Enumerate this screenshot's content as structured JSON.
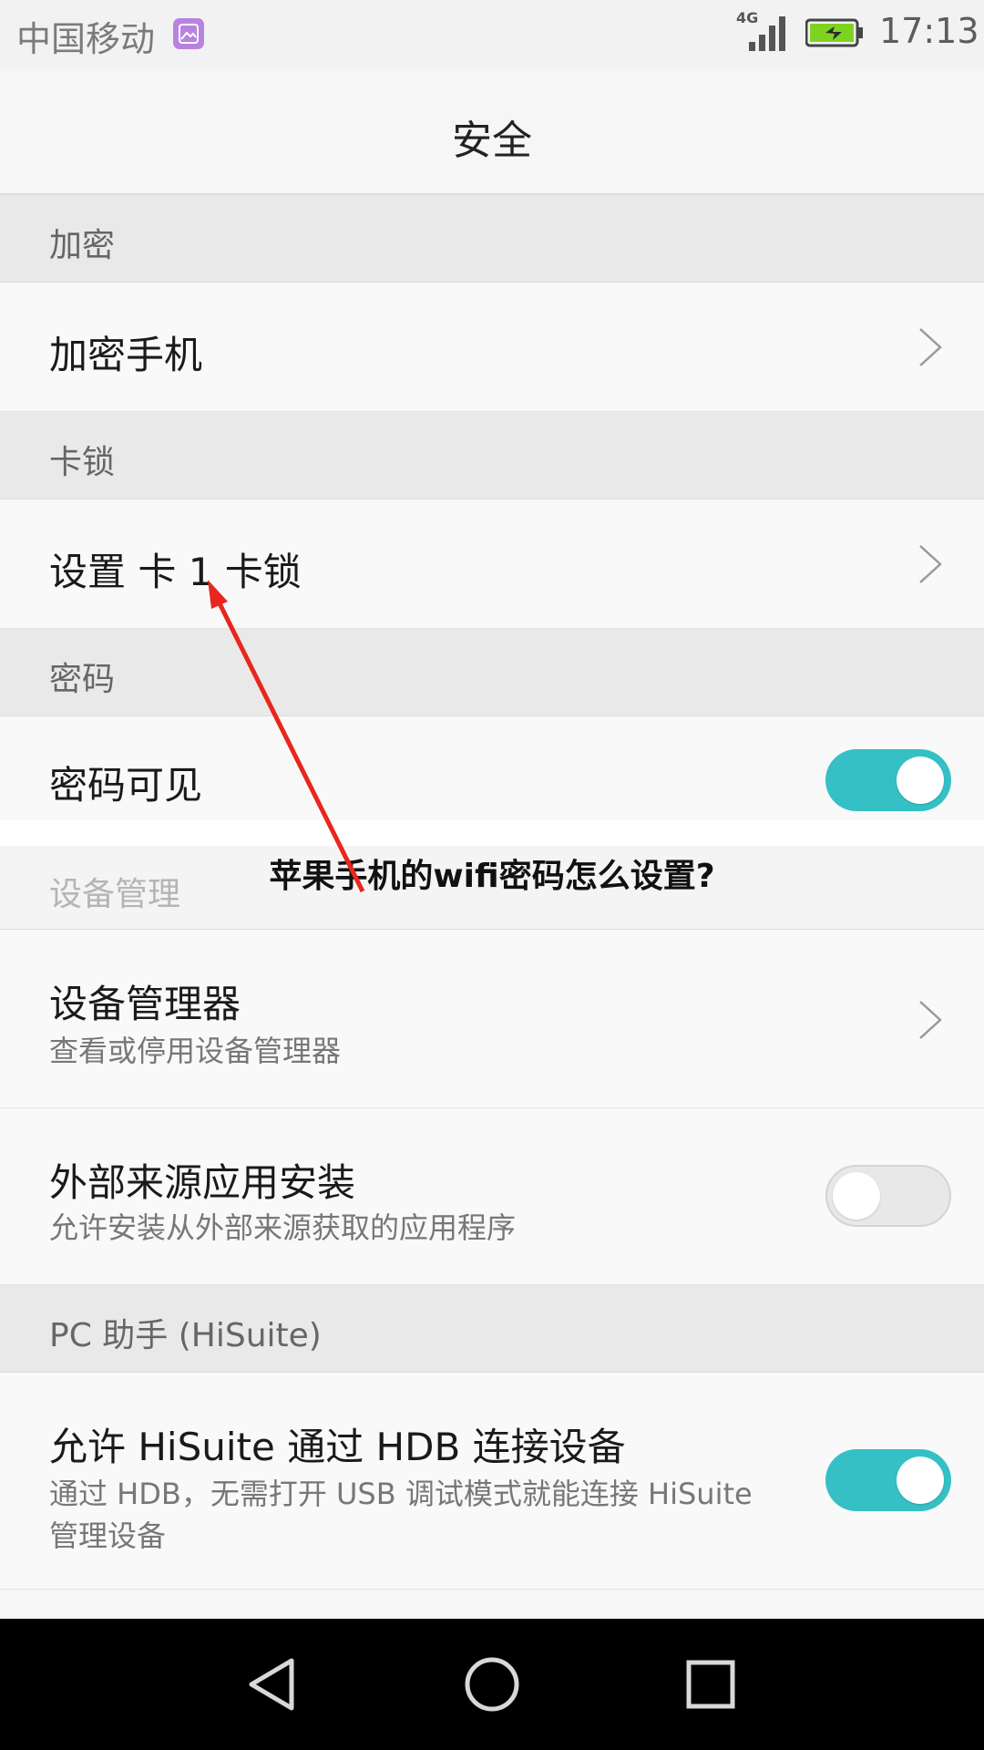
{
  "status": {
    "carrier": "中国移动",
    "network": "4G",
    "time": "17:13",
    "icons": [
      "gallery-notification-icon",
      "signal-icon",
      "battery-charging-icon"
    ]
  },
  "header": {
    "title": "安全"
  },
  "sections": {
    "encryption": "加密",
    "sim_lock": "卡锁",
    "password": "密码",
    "device_admin": "设备管理",
    "hisuite": "PC 助手 (HiSuite)"
  },
  "rows": {
    "encrypt_phone": {
      "title": "加密手机"
    },
    "sim_lock_setup": {
      "title": "设置 卡 1 卡锁"
    },
    "show_password": {
      "title": "密码可见",
      "on": true
    },
    "device_admins": {
      "title": "设备管理器",
      "subtitle": "查看或停用设备管理器"
    },
    "unknown_sources": {
      "title": "外部来源应用安装",
      "subtitle": "允许安装从外部来源获取的应用程序",
      "on": false
    },
    "hisuite_hdb": {
      "title": "允许 HiSuite 通过 HDB 连接设备",
      "subtitle": "通过 HDB，无需打开 USB 调试模式就能连接 HiSuite 管理设备",
      "on": true
    }
  },
  "overlay": {
    "caption": "苹果手机的wifi密码怎么设置?"
  },
  "colors": {
    "toggle_on": "#35c0c5",
    "toggle_off": "#e8e8e8",
    "arrow": "#e8261f",
    "navbar": "#000000"
  },
  "navbar": {
    "icons": [
      "back-icon",
      "home-icon",
      "recents-icon"
    ]
  }
}
